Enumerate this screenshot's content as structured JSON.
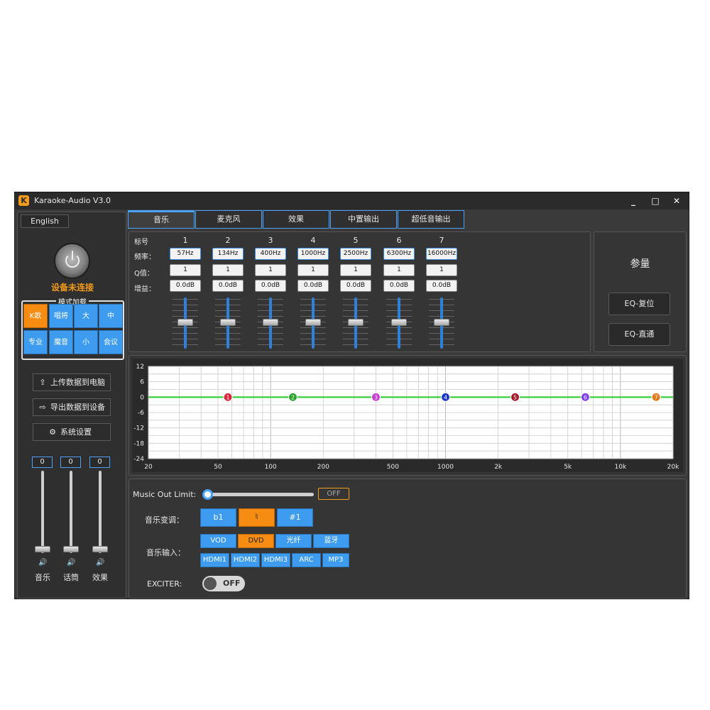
{
  "window": {
    "title": "Karaoke-Audio V3.0",
    "icon_letter": "K",
    "minimize": "_",
    "maximize": "□",
    "close": "✕"
  },
  "sidebar": {
    "language": "English",
    "status": "设备未连接",
    "mode_title": "模式加载",
    "modes": [
      "K歌",
      "唱将",
      "大",
      "中",
      "专业",
      "魔音",
      "小",
      "会议"
    ],
    "active_mode": "K歌",
    "upload": "上传数据到电脑",
    "export": "导出数据到设备",
    "settings": "系统设置",
    "volumes": [
      {
        "label": "音乐",
        "value": "0"
      },
      {
        "label": "话筒",
        "value": "0"
      },
      {
        "label": "效果",
        "value": "0"
      }
    ]
  },
  "tabs": [
    "音乐",
    "麦克风",
    "效果",
    "中置输出",
    "超低音输出"
  ],
  "active_tab": "音乐",
  "eq": {
    "label_num": "标号",
    "label_freq": "频率：",
    "label_q": "Q值：",
    "label_gain": "增益：",
    "bands": [
      {
        "num": "1",
        "freq": "57Hz",
        "q": "1",
        "gain": "0.0dB"
      },
      {
        "num": "2",
        "freq": "134Hz",
        "q": "1",
        "gain": "0.0dB"
      },
      {
        "num": "3",
        "freq": "400Hz",
        "q": "1",
        "gain": "0.0dB"
      },
      {
        "num": "4",
        "freq": "1000Hz",
        "q": "1",
        "gain": "0.0dB"
      },
      {
        "num": "5",
        "freq": "2500Hz",
        "q": "1",
        "gain": "0.0dB"
      },
      {
        "num": "6",
        "freq": "6300Hz",
        "q": "1",
        "gain": "0.0dB"
      },
      {
        "num": "7",
        "freq": "16000Hz",
        "q": "1",
        "gain": "0.0dB"
      }
    ]
  },
  "params": {
    "title": "参量",
    "reset": "EQ-复位",
    "bypass": "EQ-直通"
  },
  "chart_data": {
    "type": "line",
    "y_ticks": [
      "12",
      "6",
      "0",
      "-6",
      "-12",
      "-18",
      "-24"
    ],
    "x_ticks": [
      "20",
      "50",
      "100",
      "200",
      "500",
      "1000",
      "2k",
      "5k",
      "10k",
      "20k"
    ],
    "ylim": [
      -24,
      12
    ],
    "xlim": [
      20,
      20000
    ],
    "x_scale": "log",
    "grid": true,
    "series": [
      {
        "values": [
          0,
          0
        ]
      }
    ],
    "points": [
      {
        "label": "1",
        "freq": 57,
        "gain": 0,
        "color": "#d9263a"
      },
      {
        "label": "2",
        "freq": 134,
        "gain": 0,
        "color": "#2aa52a"
      },
      {
        "label": "3",
        "freq": 400,
        "gain": 0,
        "color": "#c63bd0"
      },
      {
        "label": "4",
        "freq": 1000,
        "gain": 0,
        "color": "#1a33c9"
      },
      {
        "label": "5",
        "freq": 2500,
        "gain": 0,
        "color": "#a3182a"
      },
      {
        "label": "6",
        "freq": 6300,
        "gain": 0,
        "color": "#7a3de8"
      },
      {
        "label": "7",
        "freq": 16000,
        "gain": 0,
        "color": "#e07a16"
      }
    ],
    "line_color": "#22cc22"
  },
  "bottom": {
    "limit_label": "Music Out Limit:",
    "limit_state": "OFF",
    "limit_level": 0,
    "pitch_label": "音乐变调：",
    "pitch_buttons": [
      "b1",
      "♮",
      "#1"
    ],
    "active_pitch": "♮",
    "input_label": "音乐输入：",
    "inputs_row1": [
      "VOD",
      "DVD",
      "光纤",
      "蓝牙"
    ],
    "inputs_row2": [
      "HDMI1",
      "HDMI2",
      "HDMI3",
      "ARC",
      "MP3"
    ],
    "active_input": "DVD",
    "exciter_label": "EXCITER:",
    "exciter_state": "OFF"
  }
}
